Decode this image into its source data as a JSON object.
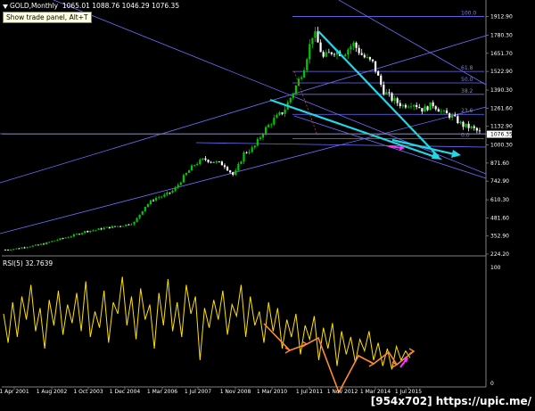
{
  "header": {
    "symbol_text": "GOLD,Monthly",
    "ohlc_text": "1065.01 1088.76 1046.29 1076.35"
  },
  "tooltip": {
    "text": "Show trade panel, Alt+T"
  },
  "rsi": {
    "label": "RSI(5) 32.7639",
    "levels": [
      "100",
      "0"
    ]
  },
  "watermark": "[954x702] https://upic.me/",
  "price_axis": [
    "1912.90",
    "1780.30",
    "1651.70",
    "1522.90",
    "1390.30",
    "1261.60",
    "1132.90",
    "1076.35",
    "1000.30",
    "871.60",
    "742.90",
    "610.30",
    "481.60",
    "352.90",
    "224.20"
  ],
  "fib_labels": [
    "100.0",
    "61.8",
    "50.0",
    "38.2",
    "23.6",
    "0.0"
  ],
  "date_axis": [
    "1 Apr 2001",
    "1 Aug 2002",
    "1 Oct 2003",
    "1 Dec 2004",
    "1 Mar 2006",
    "1 Jul 2007",
    "1 Nov 2008",
    "1 Mar 2010",
    "1 Jul 2011",
    "1 Nov 2012",
    "1 Mar 2014",
    "1 Jul 2015"
  ],
  "colors": {
    "background": "#000000",
    "bull_candle": "#00c800",
    "bear_candle": "#ffffff",
    "trend": "#6e6eff",
    "cyan": "#20d8e8",
    "rsi_line": "#ffe000",
    "orange": "#ff8a33",
    "magenta": "#ff33ff"
  },
  "chart_data": {
    "type": "candlestick",
    "y_range": [
      224.2,
      1980
    ],
    "close_path": [
      [
        0,
        255
      ],
      [
        3,
        262
      ],
      [
        6,
        275
      ],
      [
        9,
        285
      ],
      [
        12,
        300
      ],
      [
        15,
        322
      ],
      [
        18,
        340
      ],
      [
        21,
        360
      ],
      [
        24,
        385
      ],
      [
        27,
        395
      ],
      [
        30,
        410
      ],
      [
        33,
        420
      ],
      [
        36,
        430
      ],
      [
        39,
        450
      ],
      [
        42,
        560
      ],
      [
        45,
        620
      ],
      [
        48,
        640
      ],
      [
        51,
        680
      ],
      [
        54,
        780
      ],
      [
        57,
        860
      ],
      [
        60,
        900
      ],
      [
        63,
        880
      ],
      [
        66,
        860
      ],
      [
        69,
        780
      ],
      [
        72,
        940
      ],
      [
        75,
        980
      ],
      [
        78,
        1100
      ],
      [
        81,
        1180
      ],
      [
        84,
        1240
      ],
      [
        87,
        1380
      ],
      [
        90,
        1540
      ],
      [
        93,
        1810
      ],
      [
        96,
        1620
      ],
      [
        99,
        1670
      ],
      [
        102,
        1650
      ],
      [
        105,
        1720
      ],
      [
        108,
        1630
      ],
      [
        111,
        1580
      ],
      [
        114,
        1390
      ],
      [
        117,
        1320
      ],
      [
        120,
        1280
      ],
      [
        123,
        1300
      ],
      [
        126,
        1250
      ],
      [
        129,
        1290
      ],
      [
        132,
        1230
      ],
      [
        135,
        1200
      ],
      [
        138,
        1140
      ],
      [
        141,
        1120
      ],
      [
        144,
        1076
      ]
    ],
    "fib_levels": [
      {
        "label": "100.0",
        "price": 1912.9
      },
      {
        "label": "61.8",
        "price": 1522.9
      },
      {
        "label": "50.0",
        "price": 1441
      },
      {
        "label": "38.2",
        "price": 1360
      },
      {
        "label": "23.6",
        "price": 1218
      },
      {
        "label": "0.0",
        "price": 1046
      }
    ],
    "current_price": 1076.35,
    "rsi_range": [
      0,
      100
    ],
    "rsi_values": [
      60,
      35,
      70,
      40,
      75,
      55,
      85,
      45,
      65,
      30,
      72,
      50,
      80,
      42,
      68,
      52,
      78,
      45,
      88,
      40,
      62,
      48,
      80,
      35,
      70,
      60,
      92,
      50,
      75,
      38,
      82,
      55,
      68,
      30,
      78,
      50,
      90,
      45,
      70,
      40,
      85,
      60,
      75,
      20,
      65,
      48,
      72,
      55,
      80,
      42,
      68,
      58,
      85,
      40,
      75,
      50,
      62,
      35,
      70,
      45,
      65,
      30,
      55,
      40,
      60,
      25,
      50,
      38,
      58,
      20,
      48,
      30,
      52,
      15,
      45,
      25,
      40,
      18,
      38,
      28,
      45,
      20,
      35,
      15,
      30,
      12,
      32,
      20,
      28,
      22
    ]
  }
}
